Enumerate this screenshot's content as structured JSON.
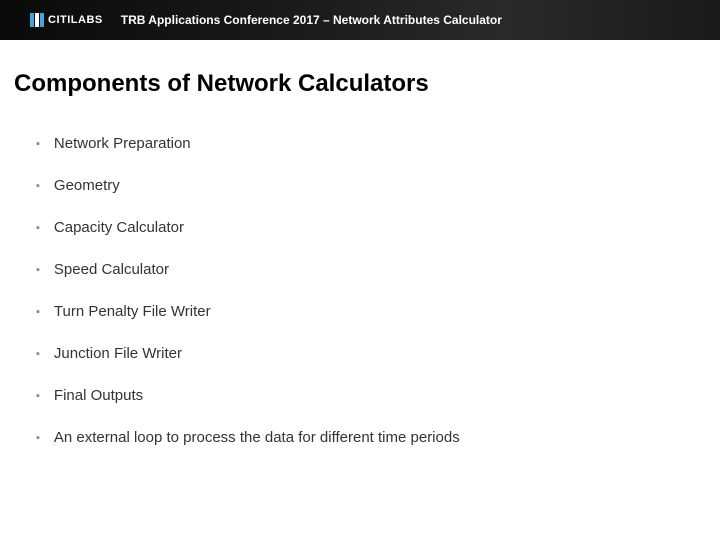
{
  "header": {
    "logo_text": "CITILABS",
    "title": "TRB Applications Conference 2017 – Network Attributes Calculator"
  },
  "slide": {
    "title": "Components of Network Calculators",
    "bullets": [
      "Network Preparation",
      "Geometry",
      "Capacity Calculator",
      "Speed Calculator",
      "Turn Penalty File Writer",
      "Junction File Writer",
      "Final Outputs",
      "An external loop to process the data for different time periods"
    ]
  }
}
